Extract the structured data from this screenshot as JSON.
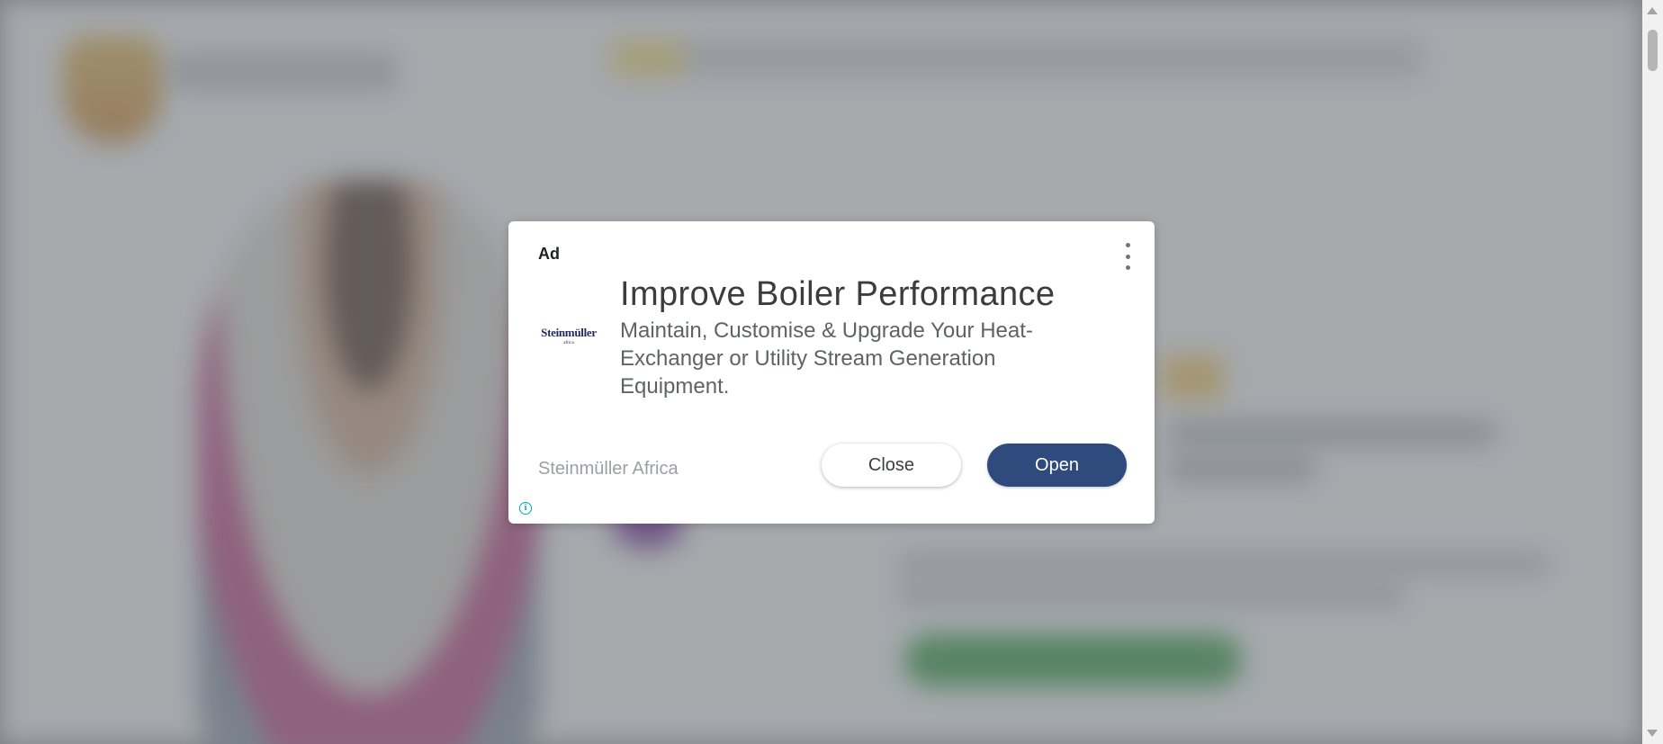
{
  "ad": {
    "label": "Ad",
    "headline": "Improve Boiler Performance",
    "body": "Maintain, Customise & Upgrade Your Heat-Exchanger or Utility Stream Generation Equipment.",
    "advertiser": "Steinmüller Africa",
    "logo_text": "Steinmüller",
    "logo_subtext": "africa",
    "close_label": "Close",
    "open_label": "Open",
    "menu_icon": "more-vert-icon",
    "info_icon": "info-icon"
  },
  "colors": {
    "open_button": "#2f4a7d",
    "info_accent": "#00a4b4",
    "overlay": "#8a8d92"
  }
}
